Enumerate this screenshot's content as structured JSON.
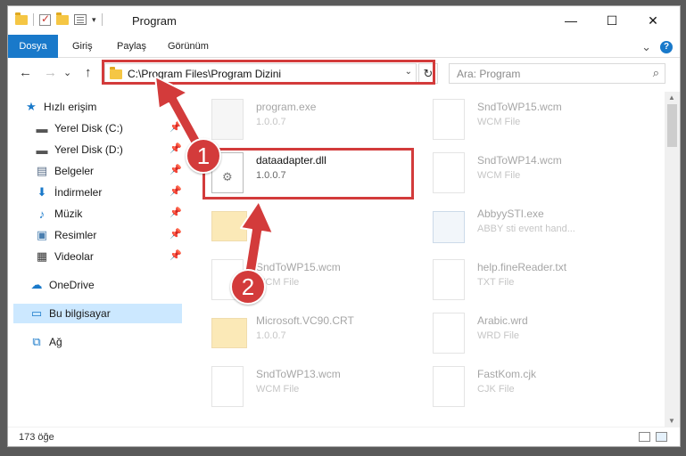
{
  "window": {
    "title": "Program",
    "min_glyph": "—",
    "max_glyph": "☐",
    "close_glyph": "✕"
  },
  "ribbon": {
    "tabs": [
      "Dosya",
      "Giriş",
      "Paylaş",
      "Görünüm"
    ],
    "accent": "#1979ca",
    "help_glyph": "?",
    "expand_glyph": "⌄"
  },
  "nav": {
    "back_glyph": "←",
    "forward_glyph": "→",
    "recent_glyph": "⌄",
    "up_glyph": "↑",
    "address": "C:\\Program Files\\Program Dizini",
    "address_drop_glyph": "⌄",
    "refresh_glyph": "↻",
    "search_placeholder": "Ara: Program",
    "search_glyph": "⌕"
  },
  "sidebar": {
    "items": [
      {
        "label": "Hızlı erişim",
        "icon": "star-icon",
        "glyph": "★",
        "color": "#1979ca",
        "pinned": false
      },
      {
        "label": "Yerel Disk (C:)",
        "icon": "drive-icon",
        "glyph": "▬",
        "color": "#555555",
        "pinned": true
      },
      {
        "label": "Yerel Disk (D:)",
        "icon": "drive-icon",
        "glyph": "▬",
        "color": "#555555",
        "pinned": true
      },
      {
        "label": "Belgeler",
        "icon": "documents-icon",
        "glyph": "▤",
        "color": "#5b6f8a",
        "pinned": true
      },
      {
        "label": "İndirmeler",
        "icon": "download-icon",
        "glyph": "⬇",
        "color": "#1979ca",
        "pinned": true
      },
      {
        "label": "Müzik",
        "icon": "music-icon",
        "glyph": "♪",
        "color": "#1979ca",
        "pinned": true
      },
      {
        "label": "Resimler",
        "icon": "pictures-icon",
        "glyph": "▣",
        "color": "#4a7fb0",
        "pinned": true
      },
      {
        "label": "Videolar",
        "icon": "video-icon",
        "glyph": "▦",
        "color": "#333333",
        "pinned": true
      },
      {
        "label": "OneDrive",
        "icon": "cloud-icon",
        "glyph": "☁",
        "color": "#1979ca",
        "pinned": false
      },
      {
        "label": "Bu bilgisayar",
        "icon": "computer-icon",
        "glyph": "▭",
        "color": "#1979ca",
        "pinned": false
      },
      {
        "label": "Ağ",
        "icon": "network-icon",
        "glyph": "⧉",
        "color": "#1979ca",
        "pinned": false
      }
    ],
    "pin_glyph": "📌"
  },
  "files": [
    {
      "name": "program.exe",
      "desc": "1.0.0.7",
      "kind": "exe"
    },
    {
      "name": "SndToWP15.wcm",
      "desc": "WCM File",
      "kind": "doc"
    },
    {
      "name": "dataadapter.dll",
      "desc": "1.0.0.7",
      "kind": "dll"
    },
    {
      "name": "SndToWP14.wcm",
      "desc": "WCM File",
      "kind": "doc"
    },
    {
      "name": "",
      "desc": "",
      "kind": "folder"
    },
    {
      "name": "AbbyySTI.exe",
      "desc": "ABBY sti event hand...",
      "kind": "app"
    },
    {
      "name": "SndToWP15.wcm",
      "desc": "WCM File",
      "kind": "doc"
    },
    {
      "name": "help.fineReader.txt",
      "desc": "TXT File",
      "kind": "doc"
    },
    {
      "name": "Microsoft.VC90.CRT",
      "desc": "1.0.0.7",
      "kind": "folder"
    },
    {
      "name": "Arabic.wrd",
      "desc": "WRD File",
      "kind": "doc"
    },
    {
      "name": "SndToWP13.wcm",
      "desc": "WCM File",
      "kind": "doc"
    },
    {
      "name": "FastKom.cjk",
      "desc": "CJK File",
      "kind": "doc"
    }
  ],
  "status": {
    "count": "173 öğe"
  },
  "annotations": {
    "callout_1": "1",
    "callout_2": "2",
    "color": "#d33b3b"
  }
}
